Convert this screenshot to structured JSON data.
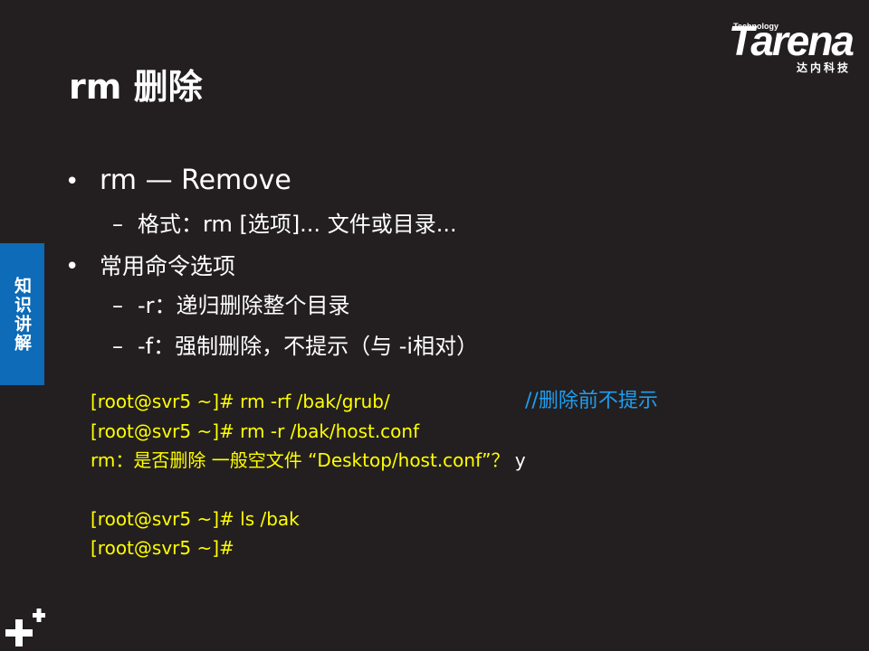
{
  "logo": {
    "tech": "Technology",
    "word": "Tarena",
    "cn": "达内科技"
  },
  "title": "rm 删除",
  "side_tab": "知识讲解",
  "bullets": [
    {
      "level": 1,
      "mark": "•",
      "text": "rm — Remove"
    },
    {
      "level": 2,
      "mark": "–",
      "text": "格式：rm  [选项]...  文件或目录..."
    },
    {
      "level": 1,
      "mark": "•",
      "text": "常用命令选项"
    },
    {
      "level": 2,
      "mark": "–",
      "text": "-r：递归删除整个目录"
    },
    {
      "level": 2,
      "mark": "–",
      "text": "-f：强制删除，不提示（与 -i相对）"
    }
  ],
  "terminal": {
    "line1": "[root@svr5 ~]# rm  -rf  /bak/grub/",
    "line1_comment": "//删除前不提示",
    "line2": "[root@svr5 ~]# rm  -r  /bak/host.conf",
    "line3": "rm：是否删除 一般空文件 “Desktop/host.conf”？",
    "line3_answer": "y",
    "line4": "[root@svr5 ~]# ls  /bak",
    "line5": "[root@svr5 ~]#"
  },
  "colors": {
    "background": "#231f20",
    "side_tab": "#0d6bb7",
    "terminal_text": "#ffff00",
    "comment_text": "#1e9ef0"
  },
  "icons": {
    "corner": "plus-icon"
  }
}
